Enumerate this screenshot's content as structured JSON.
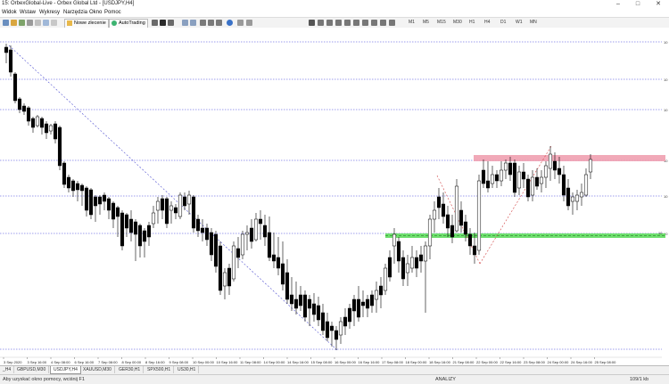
{
  "window": {
    "title": "15: OrbexGlobal-Live - Orbex Global Ltd - [USDJPY,H4]"
  },
  "menu": [
    "Widok",
    "Wstaw",
    "Wykresy",
    "Narzędzia",
    "Okno",
    "Pomoc"
  ],
  "toolbar": {
    "new_order_label": "Nowe zlecenie",
    "autotrading_label": "AutoTrading",
    "timeframes": [
      "M1",
      "M5",
      "M15",
      "M30",
      "H1",
      "H4",
      "D1",
      "W1",
      "MN"
    ]
  },
  "chart": {
    "symbol_label": "",
    "level_labels": [
      "10",
      "10",
      "10",
      "10",
      "10",
      "10"
    ],
    "level_zone_label": "10",
    "time_labels": [
      "3 Sep 2020",
      "3 Sep 16:00",
      "4 Sep 08:00",
      "6 Sep 16:00",
      "7 Sep 08:00",
      "8 Sep 00:00",
      "8 Sep 16:00",
      "9 Sep 08:00",
      "10 Sep 00:00",
      "10 Sep 16:00",
      "11 Sep 08:00",
      "14 Sep 00:00",
      "14 Sep 16:00",
      "15 Sep 08:00",
      "16 Sep 00:00",
      "16 Sep 16:00",
      "17 Sep 08:00",
      "18 Sep 00:00",
      "18 Sep 16:00",
      "21 Sep 08:00",
      "22 Sep 00:00",
      "22 Sep 16:00",
      "23 Sep 08:00",
      "24 Sep 00:00",
      "24 Sep 16:00",
      "25 Sep 08:00"
    ]
  },
  "tabs": [
    "_H4",
    "GBPUSD,M30",
    "USDJPY,H4",
    "XAUUSD,M30",
    "GER30,H1",
    "SPX500,H1",
    "US30,H1"
  ],
  "active_tab": 2,
  "status": {
    "help": "Aby uzyskać okno pomocy, wciśnij F1",
    "mode": "ANALIZY",
    "traffic": "109/1 kb"
  }
}
